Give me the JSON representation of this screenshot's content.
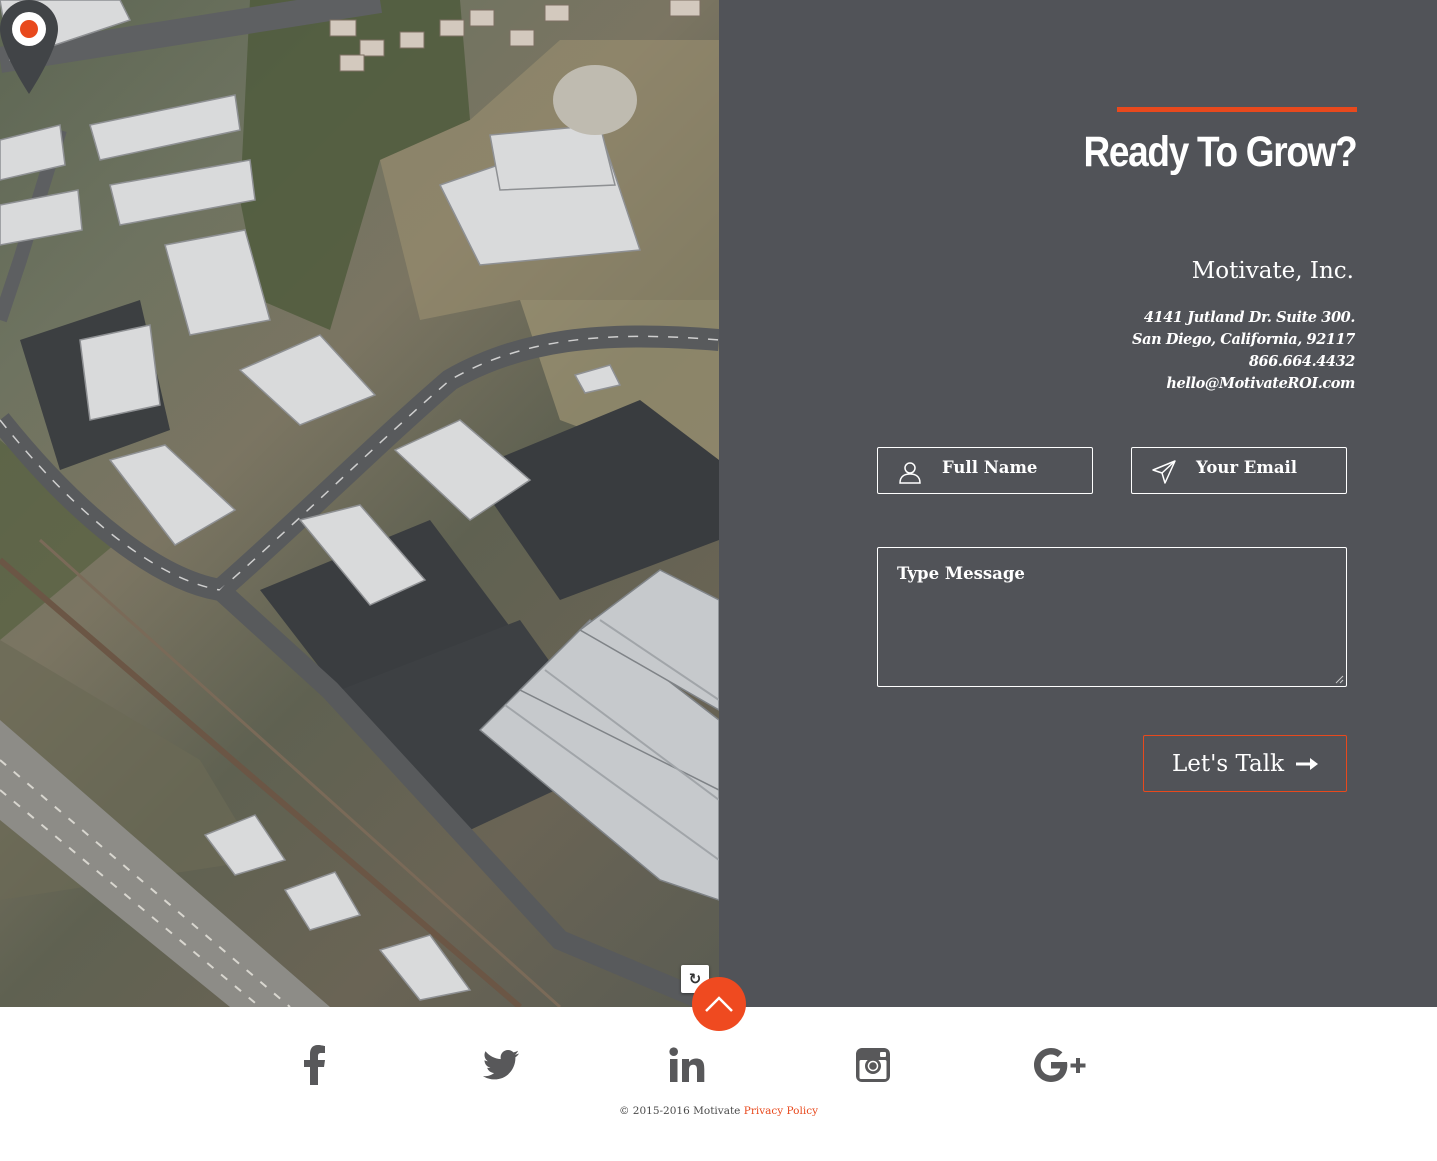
{
  "contact": {
    "headline": "Ready To Grow?",
    "company": "Motivate, Inc.",
    "address_line1": "4141 Jutland Dr. Suite 300.",
    "address_line2": "San Diego, California, 92117",
    "phone": "866.664.4432",
    "email": "hello@MotivateROI.com"
  },
  "form": {
    "name_placeholder": "Full Name",
    "email_placeholder": "Your Email",
    "message_placeholder": "Type Message",
    "submit_label": "Let's Talk"
  },
  "map": {
    "pin_icon": "location-pin-icon",
    "control_icon": "rotate-icon"
  },
  "footer": {
    "social": [
      "facebook-icon",
      "twitter-icon",
      "linkedin-icon",
      "instagram-icon",
      "google-plus-icon"
    ],
    "copyright": "© 2015-2016 Motivate",
    "privacy_label": "Privacy Policy"
  },
  "colors": {
    "accent": "#e8491d",
    "panel": "#515358",
    "social_icon": "#58585a"
  }
}
